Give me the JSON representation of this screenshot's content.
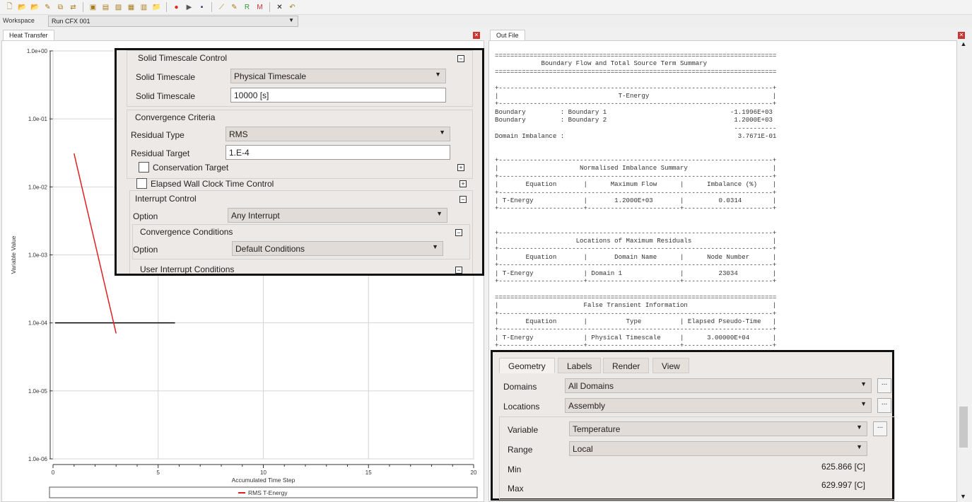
{
  "toolbar": {
    "icons": [
      "new-icon",
      "open-icon",
      "open-run-icon",
      "edit-icon",
      "copy-icon",
      "transfer-icon",
      "monitor-icon",
      "export-icon",
      "image-icon",
      "save-icon",
      "layout-icon",
      "folder-icon",
      "stop-icon",
      "play-icon",
      "disk-icon",
      "chart-edit-icon",
      "edit-run-icon",
      "rms-icon",
      "max-icon",
      "close-icon",
      "undo-icon"
    ],
    "stop_label": "STOP",
    "rms_label": "RMS",
    "max_label": "MAX"
  },
  "workspace": {
    "label": "Workspace",
    "value": "Run CFX 001"
  },
  "left_tab": "Heat Transfer",
  "right_tab": "Out File",
  "chart_data": {
    "type": "line",
    "xlabel": "Accumulated Time Step",
    "ylabel": "Variable Value",
    "xlim": [
      0,
      20
    ],
    "ylim": [
      1e-06,
      1
    ],
    "yscale": "log",
    "grid": true,
    "legend": "bottom",
    "xticks": [
      "0",
      "5",
      "10",
      "15",
      "20"
    ],
    "yticks": [
      "1.0e+00",
      "1.0e-01",
      "1.0e-02",
      "1.0e-03",
      "1.0e-04",
      "1.0e-05",
      "1.0e-06"
    ],
    "series": [
      {
        "name": "RMS T-Energy",
        "color": "#e02020",
        "x": [
          1,
          3
        ],
        "y": [
          0.031,
          7e-05
        ]
      }
    ],
    "target_line": {
      "color": "#000000",
      "y": 0.0001,
      "x": [
        0.1,
        5.8
      ]
    }
  },
  "overlay": {
    "solid_timescale_control": "Solid Timescale Control",
    "solid_timescale_label": "Solid Timescale",
    "solid_timescale_value": "Physical Timescale",
    "solid_timescale2_label": "Solid Timescale",
    "solid_timescale2_value": "10000 [s]",
    "convergence_criteria": "Convergence Criteria",
    "residual_type_label": "Residual Type",
    "residual_type_value": "RMS",
    "residual_target_label": "Residual Target",
    "residual_target_value": "1.E-4",
    "conservation_target": "Conservation Target",
    "elapsed_wall": "Elapsed Wall Clock Time Control",
    "interrupt_control": "Interrupt Control",
    "option_label": "Option",
    "option_value": "Any Interrupt",
    "convergence_conditions": "Convergence Conditions",
    "option2_label": "Option",
    "option2_value": "Default Conditions",
    "user_interrupt": "User Interrupt Conditions"
  },
  "outfile": {
    "lines": [
      "=========================================================================",
      "            Boundary Flow and Total Source Term Summary",
      "=========================================================================",
      "",
      "+-----------------------------------------------------------------------+",
      "|                               T-Energy                                |",
      "+-----------------------------------------------------------------------+",
      "Boundary         : Boundary 1                                -1.1996E+03",
      "Boundary         : Boundary 2                                 1.2000E+03",
      "                                                              -----------",
      "Domain Imbalance :                                             3.7671E-01",
      "",
      "",
      "+-----------------------------------------------------------------------+",
      "|                     Normalised Imbalance Summary                      |",
      "+-----------------------------------------------------------------------+",
      "|       Equation       |      Maximum Flow      |      Imbalance (%)    |",
      "+-----------------------------------------------------------------------+",
      "| T-Energy             |       1.2000E+03       |         0.0314        |",
      "+----------------------+------------------------+-----------------------+",
      "",
      "",
      "+-----------------------------------------------------------------------+",
      "|                    Locations of Maximum Residuals                     |",
      "+-----------------------------------------------------------------------+",
      "|       Equation       |       Domain Name      |      Node Number      |",
      "+-----------------------------------------------------------------------+",
      "| T-Energy             | Domain 1               |         23034         |",
      "+----------------------+------------------------+-----------------------+",
      "",
      "=========================================================================",
      "|                      False Transient Information                      |",
      "+-----------------------------------------------------------------------+",
      "|       Equation       |          Type          | Elapsed Pseudo-Time   |",
      "+-----------------------------------------------------------------------+",
      "| T-Energy             | Physical Timescale     |      3.00000E+04      |",
      "+----------------------+------------------------+-----------------------+"
    ]
  },
  "details": {
    "tabs": [
      "Geometry",
      "Labels",
      "Render",
      "View"
    ],
    "active_tab": "Geometry",
    "domains_label": "Domains",
    "domains_value": "All Domains",
    "locations_label": "Locations",
    "locations_value": "Assembly",
    "variable_label": "Variable",
    "variable_value": "Temperature",
    "range_label": "Range",
    "range_value": "Local",
    "min_label": "Min",
    "min_value": "625.866 [C]",
    "max_label": "Max",
    "max_value": "629.997 [C]",
    "ellipsis": "..."
  }
}
